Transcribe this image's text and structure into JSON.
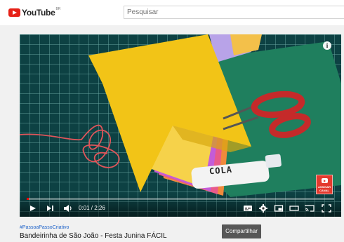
{
  "header": {
    "logo_text": "YouTube",
    "logo_region": "BR",
    "search_placeholder": "Pesquisar"
  },
  "player": {
    "overlay_text": "COLA",
    "current_time": "0:01",
    "duration": "2:26",
    "time_display": "0:01 / 2:26",
    "progress": 0.007,
    "subscribe_badge": "ASSINAR CANAL",
    "info_icon": "info-icon",
    "controls": [
      "play-icon",
      "next-icon",
      "volume-icon",
      "subtitles-icon",
      "settings-icon",
      "miniplayer-icon",
      "theater-icon",
      "cast-icon",
      "fullscreen-icon"
    ]
  },
  "video": {
    "hashtag": "#PassoaPassoCriativo",
    "title": "Bandeirinha de São João - Festa Junina FÁCIL"
  },
  "actions": {
    "share_label": "Compartilhar"
  },
  "colors": {
    "brand_red": "#e62117",
    "progress_red": "#ff0000",
    "hashtag_blue": "#1d62c9",
    "share_bg": "#575757"
  }
}
